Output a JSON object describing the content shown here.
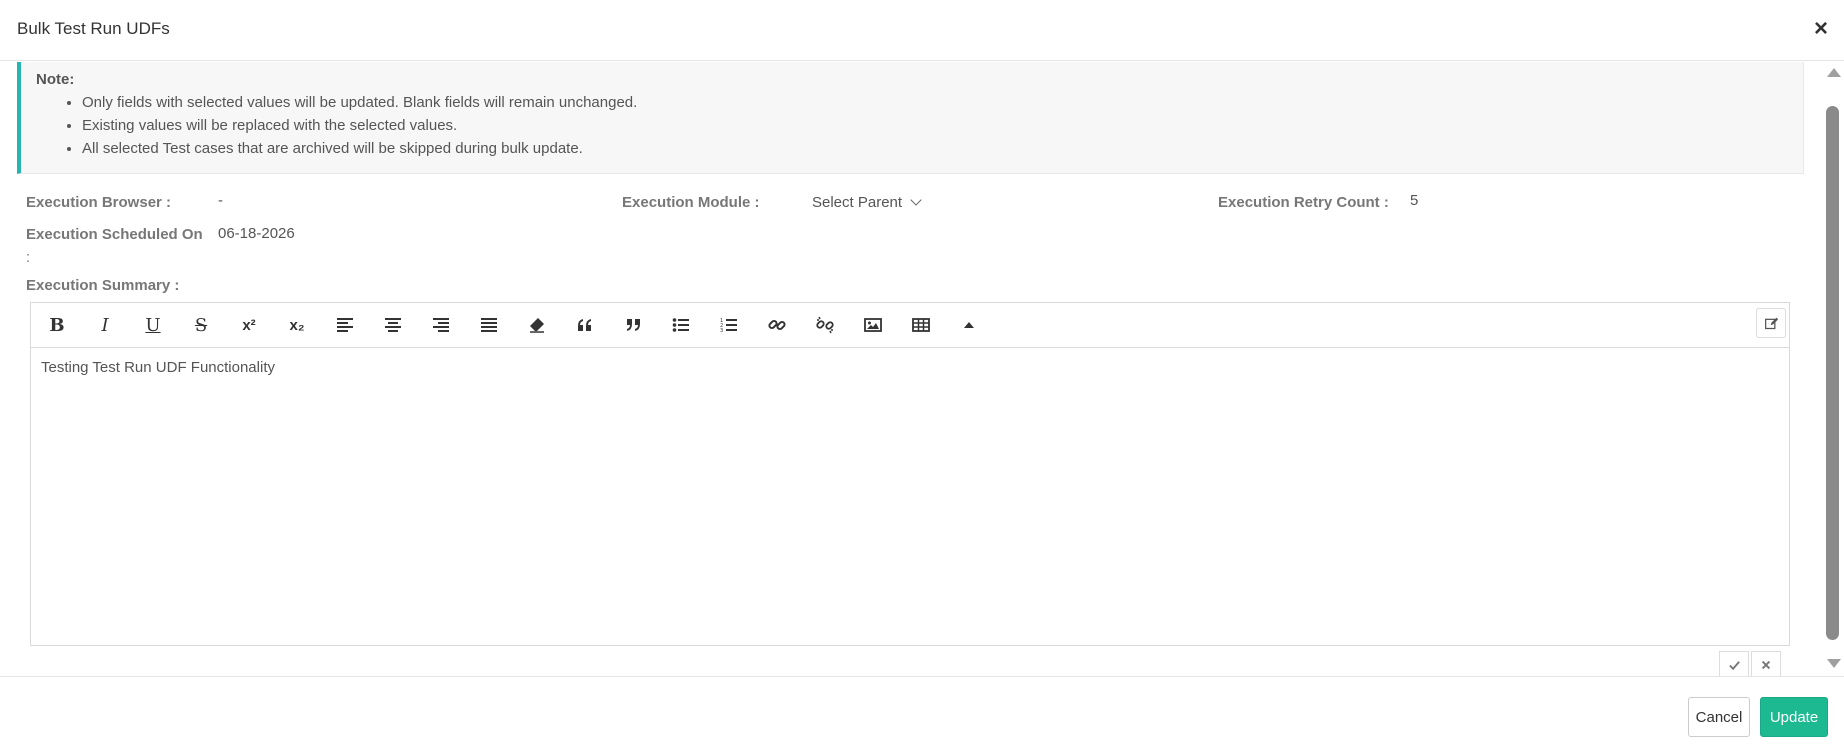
{
  "modal": {
    "title": "Bulk Test Run UDFs"
  },
  "note": {
    "title": "Note:",
    "items": [
      "Only fields with selected values will be updated. Blank fields will remain unchanged.",
      "Existing values will be replaced with the selected values.",
      "All selected Test cases that are archived will be skipped during bulk update."
    ]
  },
  "fields": {
    "browser": {
      "label": "Execution Browser :",
      "value": "-"
    },
    "module": {
      "label": "Execution Module :",
      "value": "Select Parent"
    },
    "retry": {
      "label": "Execution Retry Count :",
      "value": "5"
    },
    "scheduled": {
      "label": "Execution Scheduled On",
      "label_suffix": ":",
      "value": "06-18-2026"
    },
    "summary": {
      "label": "Execution Summary :"
    }
  },
  "editor": {
    "content": "Testing Test Run UDF Functionality",
    "toolbar": {
      "bold": "B",
      "italic": "I",
      "underline": "U",
      "strike": "S",
      "superscript": "x²",
      "subscript": "x₂"
    }
  },
  "footer": {
    "cancel_label": "Cancel",
    "update_label": "Update"
  },
  "colors": {
    "accent": "#26b5b0",
    "primary_button": "#1db991"
  }
}
